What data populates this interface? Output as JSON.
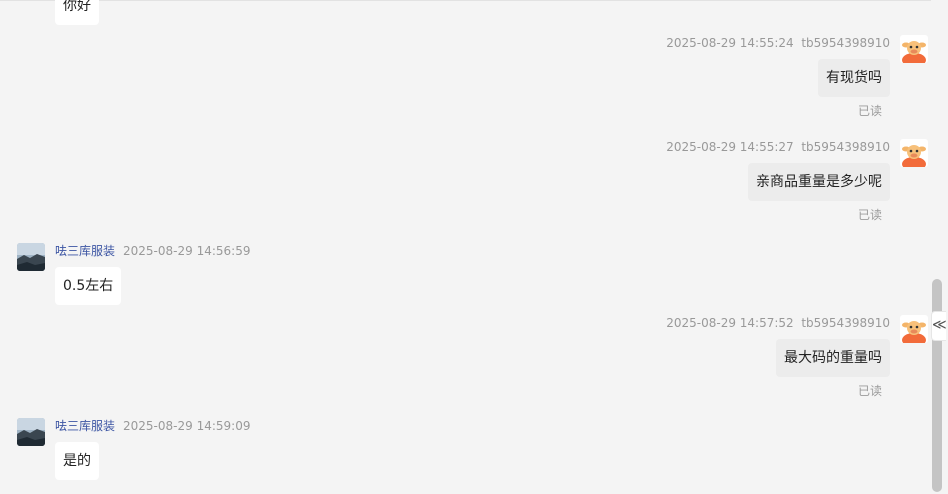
{
  "messages": [
    {
      "direction": "in",
      "text": "你好"
    },
    {
      "direction": "out",
      "time": "2025-08-29 14:55:24",
      "user": "tb5954398910",
      "text": "有现货吗",
      "status": "已读"
    },
    {
      "direction": "out",
      "time": "2025-08-29 14:55:27",
      "user": "tb5954398910",
      "text": "亲商品重量是多少呢",
      "status": "已读"
    },
    {
      "direction": "in",
      "sender": "呿三库服装",
      "time": "2025-08-29 14:56:59",
      "text": "0.5左右"
    },
    {
      "direction": "out",
      "time": "2025-08-29 14:57:52",
      "user": "tb5954398910",
      "text": "最大码的重量吗",
      "status": "已读"
    },
    {
      "direction": "in",
      "sender": "呿三库服装",
      "time": "2025-08-29 14:59:09",
      "text": "是的"
    }
  ],
  "ui": {
    "collapse_glyph": "≪",
    "buyer_avatar_icon": "cartoon-cow-avatar-icon",
    "seller_avatar_icon": "landscape-photo-avatar-icon"
  }
}
